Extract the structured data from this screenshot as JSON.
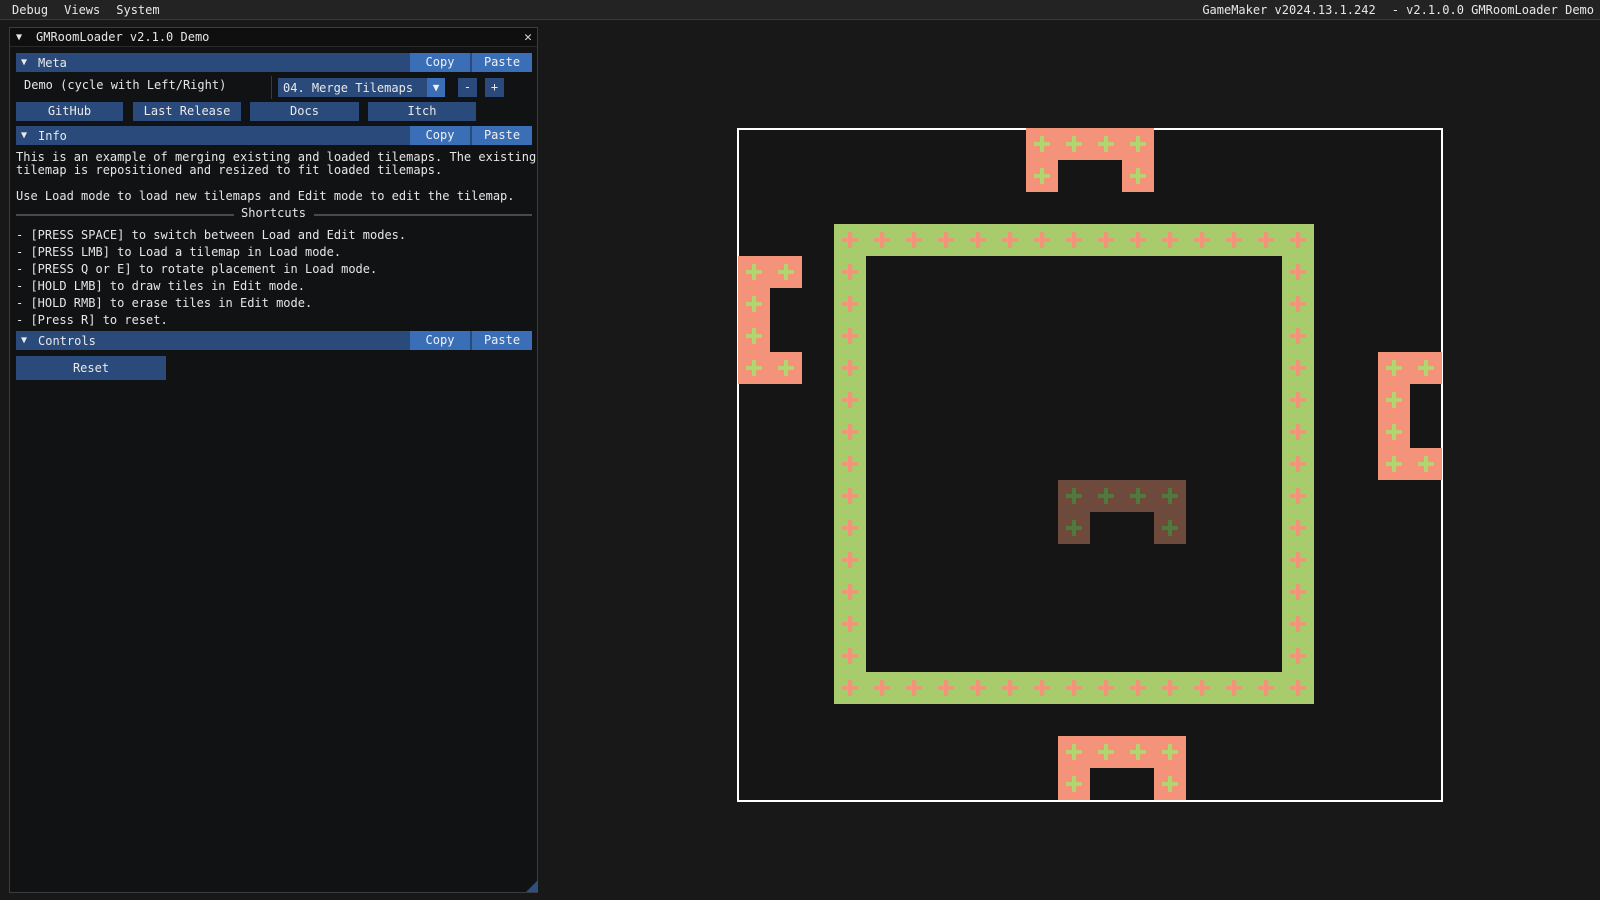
{
  "menubar": {
    "items": [
      "Debug",
      "Views",
      "System"
    ],
    "right_version": "GameMaker v2024.13.1.242",
    "right_app": "- v2.1.0.0 GMRoomLoader Demo"
  },
  "window": {
    "title": "GMRoomLoader v2.1.0 Demo",
    "close_glyph": "✕",
    "collapse_glyph": "▼"
  },
  "sections": {
    "meta": {
      "label": "Meta",
      "copy": "Copy",
      "paste": "Paste"
    },
    "info": {
      "label": "Info",
      "copy": "Copy",
      "paste": "Paste"
    },
    "controls": {
      "label": "Controls",
      "copy": "Copy",
      "paste": "Paste"
    }
  },
  "meta": {
    "demo_label": "Demo (cycle with Left/Right)",
    "demo_selected": "04. Merge Tilemaps",
    "combo_arrow": "▼",
    "minus": "-",
    "plus": "+",
    "links": [
      "GitHub",
      "Last Release",
      "Docs",
      "Itch"
    ]
  },
  "info": {
    "line1": "This is an example of merging existing and loaded tilemaps. The existing",
    "line2": "tilemap is repositioned and resized to fit loaded tilemaps.",
    "line3": "Use Load mode to load new tilemaps and Edit mode to edit the tilemap.",
    "shortcuts_title": "Shortcuts",
    "shortcuts": [
      "- [PRESS SPACE] to switch between Load and Edit modes.",
      "- [PRESS LMB] to Load a tilemap in Load mode.",
      "- [PRESS Q or E] to rotate placement in Load mode.",
      "- [HOLD LMB] to draw tiles in Edit mode.",
      "- [HOLD RMB] to erase tiles in Edit mode.",
      "- [Press R] to reset."
    ]
  },
  "controls": {
    "reset_label": "Reset"
  },
  "colors": {
    "salmon_tile": "#f3947a",
    "green_tile": "#a8cc6b",
    "brown_tile": "#6e4a3d",
    "header_blue": "#294a7a",
    "button_blue": "#3a6fb8"
  }
}
